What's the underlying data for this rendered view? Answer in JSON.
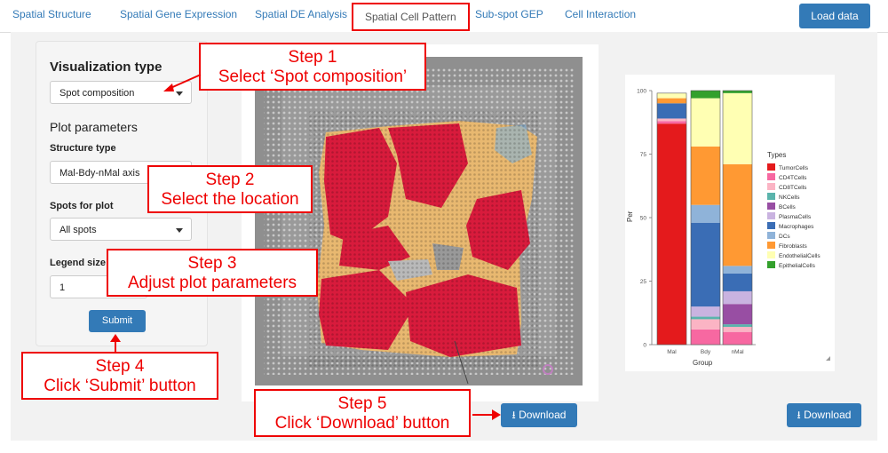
{
  "nav": {
    "tabs": [
      "Spatial Structure",
      "Spatial Gene Expression",
      "Spatial DE Analysis",
      "Spatial Cell Pattern",
      "Sub-spot GEP",
      "Cell Interaction"
    ],
    "active_tab": "Spatial Cell Pattern",
    "load_button": "Load data"
  },
  "sidebar": {
    "vis_type_heading": "Visualization type",
    "vis_type_value": "Spot composition",
    "plot_params_heading": "Plot parameters",
    "structure_label": "Structure type",
    "structure_value": "Mal-Bdy-nMal axis",
    "spots_label": "Spots for plot",
    "spots_value": "All spots",
    "legend_label": "Legend size",
    "legend_value": "1",
    "submit_button": "Submit"
  },
  "steps": [
    {
      "title": "Step 1",
      "text": "Select ‘Spot composition’"
    },
    {
      "title": "Step 2",
      "text": "Select the location"
    },
    {
      "title": "Step 3",
      "text": "Adjust plot parameters"
    },
    {
      "title": "Step 4",
      "text": "Click ‘Submit’ button"
    },
    {
      "title": "Step 5",
      "text": "Click ‘Download’ button"
    }
  ],
  "download_button": "Download",
  "colors": {
    "accent": "#337ab7",
    "callout": "#ee0000"
  },
  "chart_data": {
    "type": "bar",
    "stacked": true,
    "xlabel": "Group",
    "ylabel": "Per",
    "ylim": [
      0,
      100
    ],
    "yticks": [
      0,
      25,
      50,
      75,
      100
    ],
    "categories": [
      "Mal",
      "Bdy",
      "nMal"
    ],
    "legend_title": "Types",
    "legend_position": "right",
    "series": [
      {
        "name": "TumorCells",
        "color": "#e41a1c",
        "values": [
          87,
          0,
          0
        ]
      },
      {
        "name": "CD4TCells",
        "color": "#f768a1",
        "values": [
          1,
          6,
          5
        ]
      },
      {
        "name": "CD8TCells",
        "color": "#fbb4c4",
        "values": [
          1,
          4,
          2
        ]
      },
      {
        "name": "NKCells",
        "color": "#5ab4ac",
        "values": [
          0,
          1,
          1
        ]
      },
      {
        "name": "BCells",
        "color": "#984ea3",
        "values": [
          0,
          0,
          8
        ]
      },
      {
        "name": "PlasmaCells",
        "color": "#c9b3e0",
        "values": [
          0,
          4,
          5
        ]
      },
      {
        "name": "Macrophages",
        "color": "#3a6db5",
        "values": [
          6,
          33,
          7
        ]
      },
      {
        "name": "DCs",
        "color": "#8fb3d9",
        "values": [
          0,
          7,
          3
        ]
      },
      {
        "name": "Fibroblasts",
        "color": "#ff9933",
        "values": [
          2,
          23,
          40
        ]
      },
      {
        "name": "EndothelialCells",
        "color": "#ffffb3",
        "values": [
          2,
          19,
          28
        ]
      },
      {
        "name": "EpithelialCells",
        "color": "#33a02c",
        "values": [
          0,
          3,
          1
        ]
      }
    ]
  }
}
